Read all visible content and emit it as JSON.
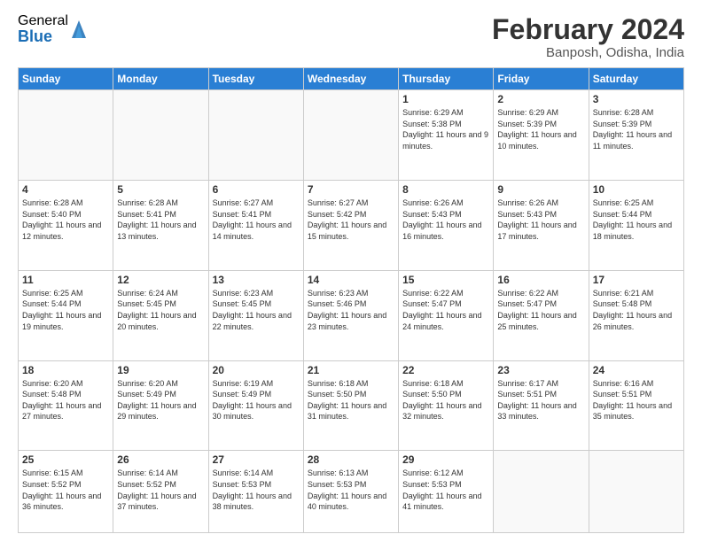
{
  "header": {
    "logo_general": "General",
    "logo_blue": "Blue",
    "title": "February 2024",
    "location": "Banposh, Odisha, India"
  },
  "days_of_week": [
    "Sunday",
    "Monday",
    "Tuesday",
    "Wednesday",
    "Thursday",
    "Friday",
    "Saturday"
  ],
  "weeks": [
    [
      {
        "num": "",
        "info": ""
      },
      {
        "num": "",
        "info": ""
      },
      {
        "num": "",
        "info": ""
      },
      {
        "num": "",
        "info": ""
      },
      {
        "num": "1",
        "info": "Sunrise: 6:29 AM\nSunset: 5:38 PM\nDaylight: 11 hours and 9 minutes."
      },
      {
        "num": "2",
        "info": "Sunrise: 6:29 AM\nSunset: 5:39 PM\nDaylight: 11 hours and 10 minutes."
      },
      {
        "num": "3",
        "info": "Sunrise: 6:28 AM\nSunset: 5:39 PM\nDaylight: 11 hours and 11 minutes."
      }
    ],
    [
      {
        "num": "4",
        "info": "Sunrise: 6:28 AM\nSunset: 5:40 PM\nDaylight: 11 hours and 12 minutes."
      },
      {
        "num": "5",
        "info": "Sunrise: 6:28 AM\nSunset: 5:41 PM\nDaylight: 11 hours and 13 minutes."
      },
      {
        "num": "6",
        "info": "Sunrise: 6:27 AM\nSunset: 5:41 PM\nDaylight: 11 hours and 14 minutes."
      },
      {
        "num": "7",
        "info": "Sunrise: 6:27 AM\nSunset: 5:42 PM\nDaylight: 11 hours and 15 minutes."
      },
      {
        "num": "8",
        "info": "Sunrise: 6:26 AM\nSunset: 5:43 PM\nDaylight: 11 hours and 16 minutes."
      },
      {
        "num": "9",
        "info": "Sunrise: 6:26 AM\nSunset: 5:43 PM\nDaylight: 11 hours and 17 minutes."
      },
      {
        "num": "10",
        "info": "Sunrise: 6:25 AM\nSunset: 5:44 PM\nDaylight: 11 hours and 18 minutes."
      }
    ],
    [
      {
        "num": "11",
        "info": "Sunrise: 6:25 AM\nSunset: 5:44 PM\nDaylight: 11 hours and 19 minutes."
      },
      {
        "num": "12",
        "info": "Sunrise: 6:24 AM\nSunset: 5:45 PM\nDaylight: 11 hours and 20 minutes."
      },
      {
        "num": "13",
        "info": "Sunrise: 6:23 AM\nSunset: 5:45 PM\nDaylight: 11 hours and 22 minutes."
      },
      {
        "num": "14",
        "info": "Sunrise: 6:23 AM\nSunset: 5:46 PM\nDaylight: 11 hours and 23 minutes."
      },
      {
        "num": "15",
        "info": "Sunrise: 6:22 AM\nSunset: 5:47 PM\nDaylight: 11 hours and 24 minutes."
      },
      {
        "num": "16",
        "info": "Sunrise: 6:22 AM\nSunset: 5:47 PM\nDaylight: 11 hours and 25 minutes."
      },
      {
        "num": "17",
        "info": "Sunrise: 6:21 AM\nSunset: 5:48 PM\nDaylight: 11 hours and 26 minutes."
      }
    ],
    [
      {
        "num": "18",
        "info": "Sunrise: 6:20 AM\nSunset: 5:48 PM\nDaylight: 11 hours and 27 minutes."
      },
      {
        "num": "19",
        "info": "Sunrise: 6:20 AM\nSunset: 5:49 PM\nDaylight: 11 hours and 29 minutes."
      },
      {
        "num": "20",
        "info": "Sunrise: 6:19 AM\nSunset: 5:49 PM\nDaylight: 11 hours and 30 minutes."
      },
      {
        "num": "21",
        "info": "Sunrise: 6:18 AM\nSunset: 5:50 PM\nDaylight: 11 hours and 31 minutes."
      },
      {
        "num": "22",
        "info": "Sunrise: 6:18 AM\nSunset: 5:50 PM\nDaylight: 11 hours and 32 minutes."
      },
      {
        "num": "23",
        "info": "Sunrise: 6:17 AM\nSunset: 5:51 PM\nDaylight: 11 hours and 33 minutes."
      },
      {
        "num": "24",
        "info": "Sunrise: 6:16 AM\nSunset: 5:51 PM\nDaylight: 11 hours and 35 minutes."
      }
    ],
    [
      {
        "num": "25",
        "info": "Sunrise: 6:15 AM\nSunset: 5:52 PM\nDaylight: 11 hours and 36 minutes."
      },
      {
        "num": "26",
        "info": "Sunrise: 6:14 AM\nSunset: 5:52 PM\nDaylight: 11 hours and 37 minutes."
      },
      {
        "num": "27",
        "info": "Sunrise: 6:14 AM\nSunset: 5:53 PM\nDaylight: 11 hours and 38 minutes."
      },
      {
        "num": "28",
        "info": "Sunrise: 6:13 AM\nSunset: 5:53 PM\nDaylight: 11 hours and 40 minutes."
      },
      {
        "num": "29",
        "info": "Sunrise: 6:12 AM\nSunset: 5:53 PM\nDaylight: 11 hours and 41 minutes."
      },
      {
        "num": "",
        "info": ""
      },
      {
        "num": "",
        "info": ""
      }
    ]
  ]
}
